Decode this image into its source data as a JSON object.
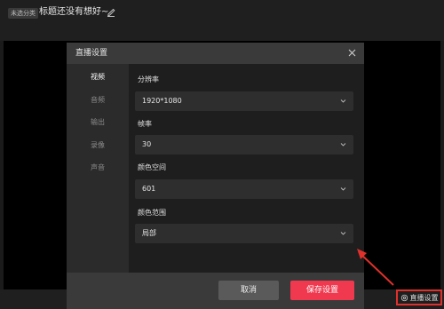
{
  "header": {
    "tag": "未选分类",
    "title": "标题还没有想好~"
  },
  "live_settings_button": {
    "label": "直播设置"
  },
  "modal": {
    "title": "直播设置",
    "sidebar": [
      {
        "label": "视频",
        "active": true
      },
      {
        "label": "音频",
        "active": false
      },
      {
        "label": "输出",
        "active": false
      },
      {
        "label": "录像",
        "active": false
      },
      {
        "label": "声音",
        "active": false
      }
    ],
    "fields": [
      {
        "label": "分辨率",
        "value": "1920*1080"
      },
      {
        "label": "帧率",
        "value": "30"
      },
      {
        "label": "颜色空间",
        "value": "601"
      },
      {
        "label": "颜色范围",
        "value": "局部"
      }
    ],
    "cancel_label": "取消",
    "save_label": "保存设置"
  },
  "colors": {
    "accent": "#f0394f",
    "annotation": "#e0302b"
  }
}
